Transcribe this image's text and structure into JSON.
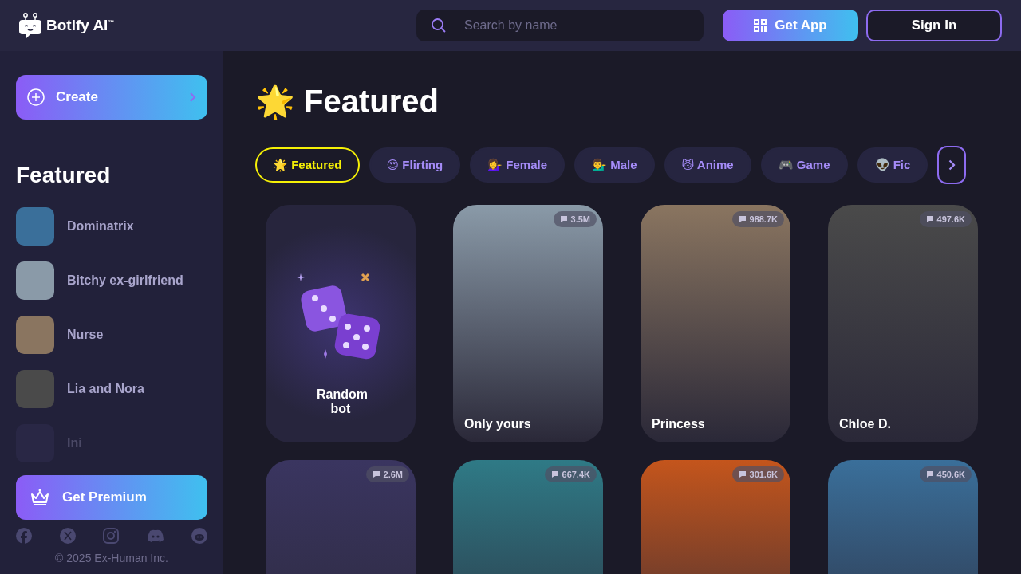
{
  "header": {
    "logo": "Botify AI",
    "trademark": "™",
    "search": {
      "placeholder": "Search by name"
    },
    "get_app": "Get App",
    "sign_in": "Sign In"
  },
  "sidebar": {
    "create": "Create",
    "section_title": "Featured",
    "items": [
      {
        "name": "Dominatrix",
        "faded": false
      },
      {
        "name": "Bitchy ex-girlfriend",
        "faded": false
      },
      {
        "name": "Nurse",
        "faded": false
      },
      {
        "name": "Lia and Nora",
        "faded": false
      },
      {
        "name": "Ini",
        "faded": true
      }
    ],
    "premium": "Get Premium",
    "copyright": "© 2025 Ex-Human Inc."
  },
  "main": {
    "title_icon": "🌟",
    "title": "Featured",
    "tabs": [
      {
        "icon": "🌟",
        "label": "Featured",
        "selected": true
      },
      {
        "icon": "😍",
        "label": "Flirting",
        "selected": false
      },
      {
        "icon": "💁‍♀️",
        "label": "Female",
        "selected": false
      },
      {
        "icon": "💁‍♂️",
        "label": "Male",
        "selected": false
      },
      {
        "icon": "😼",
        "label": "Anime",
        "selected": false
      },
      {
        "icon": "🎮",
        "label": "Game",
        "selected": false
      },
      {
        "icon": "👽",
        "label": "Fic",
        "selected": false
      }
    ],
    "cards": [
      {
        "kind": "random",
        "name": "Random bot"
      },
      {
        "kind": "bot",
        "name": "Only yours",
        "count": "3.5M"
      },
      {
        "kind": "bot",
        "name": "Princess",
        "count": "988.7K"
      },
      {
        "kind": "bot",
        "name": "Chloe D.",
        "count": "497.6K"
      },
      {
        "kind": "bot",
        "count": "2.6M"
      },
      {
        "kind": "bot",
        "count": "667.4K"
      },
      {
        "kind": "bot",
        "count": "301.6K"
      },
      {
        "kind": "bot",
        "count": "450.6K"
      }
    ]
  }
}
